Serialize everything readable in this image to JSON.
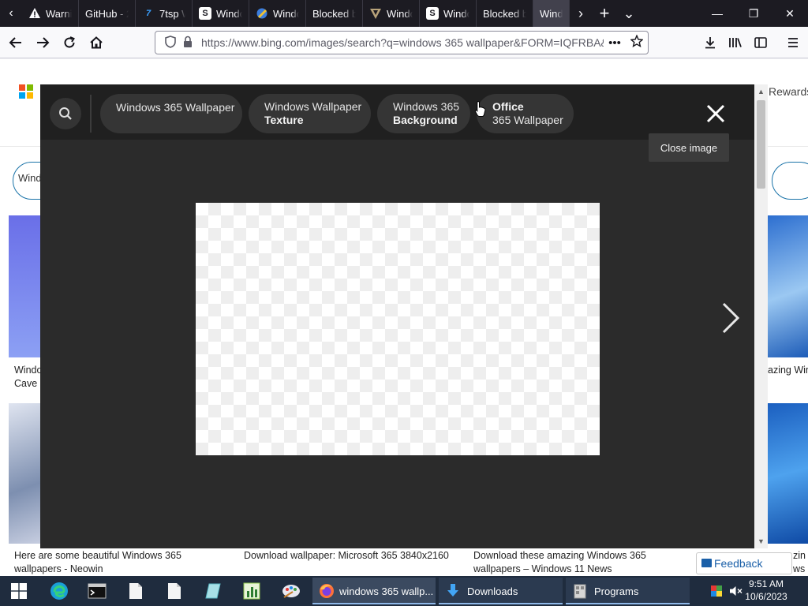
{
  "browser": {
    "tabs": [
      {
        "label": "Warning",
        "favicon": "warning-icon"
      },
      {
        "label": "GitHub - 2",
        "favicon": "none"
      },
      {
        "label": "7tsp W",
        "favicon": "7tsp-icon"
      },
      {
        "label": "Windows",
        "favicon": "s-letter-icon"
      },
      {
        "label": "Windows",
        "favicon": "globe-pencil-icon"
      },
      {
        "label": "Blocked by",
        "favicon": "none"
      },
      {
        "label": "Windows",
        "favicon": "v-shield-icon"
      },
      {
        "label": "Windows",
        "favicon": "s-letter-icon"
      },
      {
        "label": "Blocked by",
        "favicon": "none"
      },
      {
        "label": "Windows",
        "favicon": "none"
      }
    ],
    "tab_scroll_left": "‹",
    "tab_scroll_right": "›",
    "new_tab": "+",
    "tab_list": "⌄",
    "minimize": "—",
    "restore": "❐",
    "close": "✕",
    "url": "https://www.bing.com/images/search?q=windows 365 wallpaper&FORM=IQFRBA&",
    "more": "•••"
  },
  "page": {
    "rewards_label": "Rewards",
    "left_pill_text": "Wind",
    "captions": {
      "left_top": "Windo\nCave",
      "right_top": "azing Win",
      "bottom_1": "Here are some beautiful Windows 365\nwallpapers - Neowin",
      "bottom_2": "Download wallpaper: Microsoft 365 3840x2160",
      "bottom_3": "Download these amazing Windows 365\nwallpapers – Windows 11 News",
      "bottom_4_tail": "zin\nws 1"
    },
    "feedback_label": "Feedback"
  },
  "overlay": {
    "chips": [
      {
        "line1": "Windows 365 Wallpaper",
        "line2": ""
      },
      {
        "line1": "Windows Wallpaper",
        "line2": "Texture"
      },
      {
        "line1": "Windows 365",
        "line2": "Background"
      },
      {
        "line1": "Office",
        "line2": "365 Wallpaper"
      }
    ],
    "close_tooltip": "Close image"
  },
  "taskbar": {
    "apps": [
      {
        "label": "windows 365 wallp...",
        "icon": "firefox-icon"
      },
      {
        "label": "Downloads",
        "icon": "download-arrow-icon"
      },
      {
        "label": "Programs",
        "icon": "programs-folder-icon"
      }
    ],
    "time": "9:51 AM",
    "date": "10/6/2023"
  },
  "colors": {
    "tab_strip": "#1c1b22",
    "overlay_bg": "#2b2b2b",
    "overlay_header": "#202020",
    "taskbar": "#1f2c3e",
    "link_blue": "#1a5fa8"
  }
}
